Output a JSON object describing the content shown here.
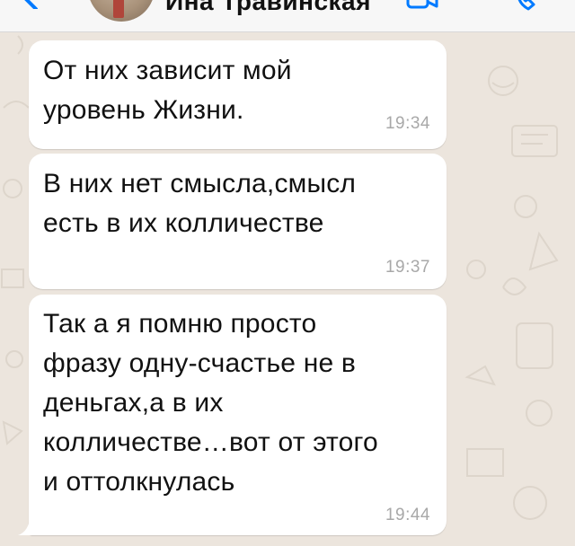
{
  "header": {
    "contact_name": "Ина Травинская",
    "back_icon": "chevron-left-icon",
    "video_icon": "video-camera-icon",
    "call_icon": "phone-icon"
  },
  "messages": [
    {
      "lines": [
        "От них зависит мой",
        "уровень Жизни."
      ],
      "time": "19:34"
    },
    {
      "lines": [
        "В них нет смысла,смысл",
        "есть в их колличестве"
      ],
      "time": "19:37"
    },
    {
      "lines": [
        "Так а я помню просто",
        "фразу одну-счастье не в",
        "деньгах,а в их",
        "колличестве…вот от этого",
        "и оттолкнулась"
      ],
      "time": "19:44"
    }
  ],
  "colors": {
    "accent": "#007aff",
    "background": "#ece5dd",
    "bubble": "#ffffff",
    "timestamp": "#a8a8a8"
  }
}
